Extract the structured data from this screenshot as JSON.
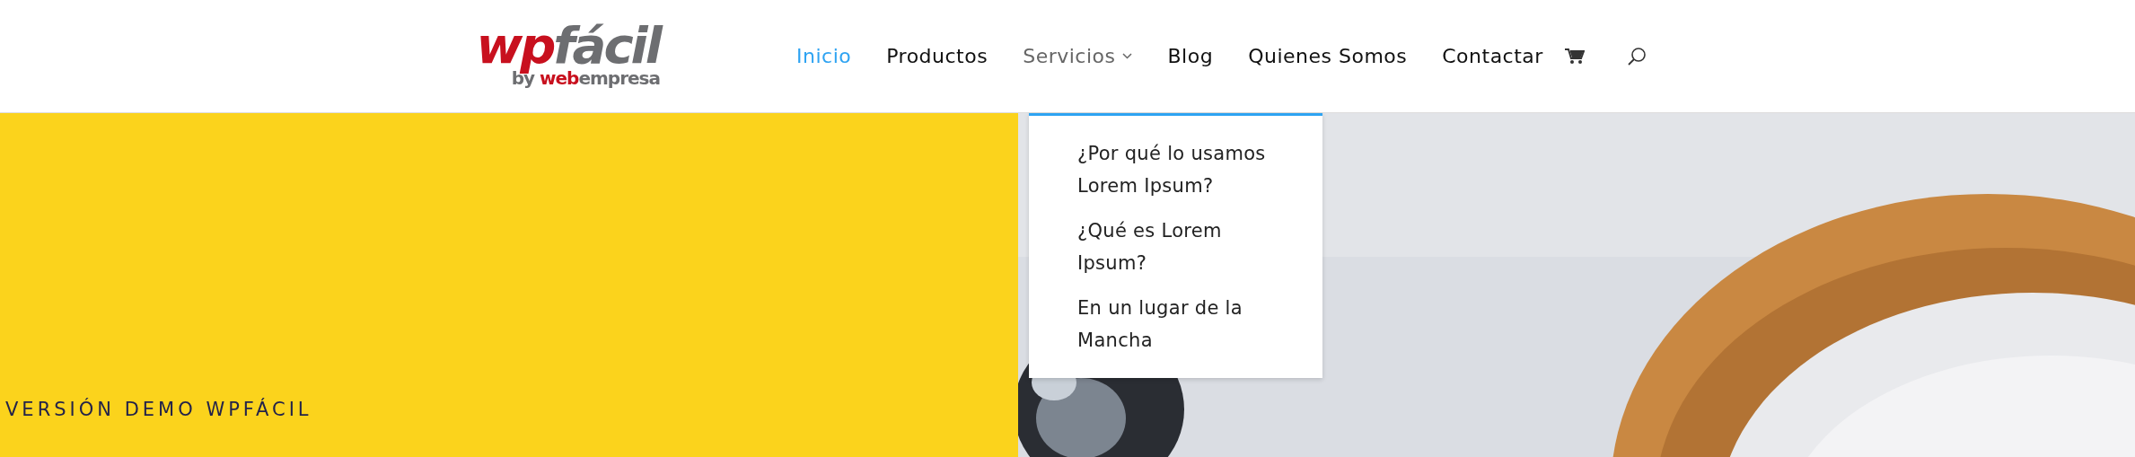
{
  "logo": {
    "main_part_1": "wp",
    "main_part_2": "fácil",
    "byline_part_1": "by ",
    "byline_part_2": "web",
    "byline_part_3": "empresa"
  },
  "nav": [
    {
      "label": "Inicio",
      "kind": "link",
      "selected": true
    },
    {
      "label": "Productos",
      "kind": "link",
      "selected": false
    },
    {
      "label": "Servicios",
      "kind": "dropdown",
      "selected": false,
      "expanded": true
    },
    {
      "label": "Blog",
      "kind": "link",
      "selected": false
    },
    {
      "label": "Quienes Somos",
      "kind": "link",
      "selected": false
    },
    {
      "label": "Contactar",
      "kind": "link",
      "selected": false
    }
  ],
  "dropdown": [
    "¿Por qué lo usamos Lorem Ipsum?",
    "¿Qué es Lorem Ipsum?",
    "En un lugar de la Mancha"
  ],
  "hero": {
    "heading": "VERSIÓN DEMO WPFÁCIL"
  }
}
